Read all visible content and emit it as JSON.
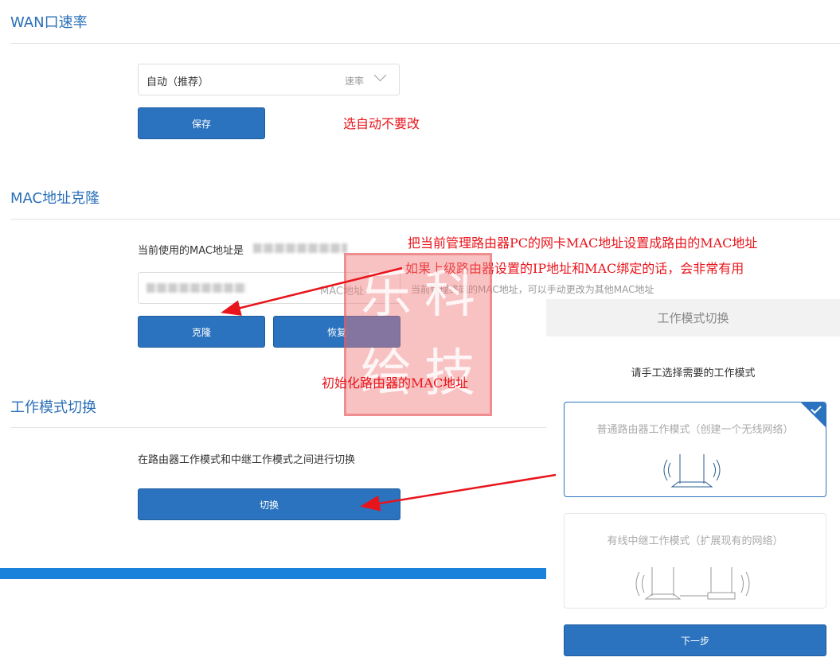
{
  "wan": {
    "title": "WAN口速率",
    "select_value": "自动（推荐）",
    "select_label": "速率",
    "save": "保存",
    "note": "选自动不要改"
  },
  "mac": {
    "title": "MAC地址克隆",
    "current_label": "当前使用的MAC地址是",
    "input_label": "MAC地址",
    "hint": "当前管理终端的MAC地址，可以手动更改为其他MAC地址",
    "clone": "克隆",
    "restore": "恢复",
    "note1": "把当前管理路由器PC的网卡MAC地址设置成路由的MAC地址",
    "note2": "如果上级路由器设置的IP地址和MAC绑定的话，会非常有用",
    "note3": "初始化路由器的MAC地址"
  },
  "mode": {
    "title": "工作模式切换",
    "desc": "在路由器工作模式和中继工作模式之间进行切换",
    "switch": "切换"
  },
  "dialog": {
    "title": "工作模式切换",
    "prompt": "请手工选择需要的工作模式",
    "option1": "普通路由器工作模式（创建一个无线网络）",
    "option2": "有线中继工作模式（扩展现有的网络）",
    "selected": 1,
    "next": "下一步"
  },
  "seal": {
    "text": "乐科绘技"
  },
  "colors": {
    "accent": "#2b73bf",
    "annotation": "#e8141b"
  }
}
